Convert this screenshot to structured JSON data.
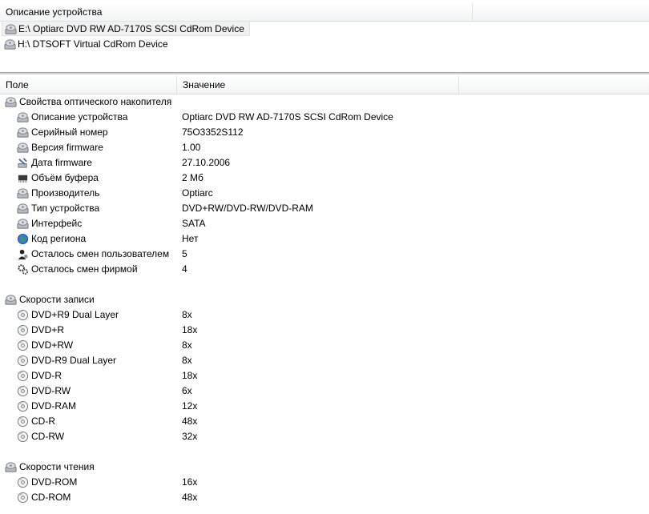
{
  "top_header": {
    "col1": "Описание устройства"
  },
  "devices": [
    {
      "label": "E:\\  Optiarc DVD RW AD-7170S SCSI CdRom Device",
      "selected": true
    },
    {
      "label": "H:\\  DTSOFT Virtual CdRom Device",
      "selected": false
    }
  ],
  "prop_header": {
    "field": "Поле",
    "value": "Значение"
  },
  "groups": [
    {
      "title": "Свойства оптического накопителя",
      "items": [
        {
          "name": "Описание устройства",
          "value": "Optiarc DVD RW AD-7170S SCSI CdRom Device",
          "icon": "drive"
        },
        {
          "name": "Серийный номер",
          "value": "75O3352S112",
          "icon": "drive"
        },
        {
          "name": "Версия firmware",
          "value": "1.00",
          "icon": "drive"
        },
        {
          "name": "Дата firmware",
          "value": "27.10.2006",
          "icon": "tools"
        },
        {
          "name": "Объём буфера",
          "value": "2 Мб",
          "icon": "chip"
        },
        {
          "name": "Производитель",
          "value": "Optiarc",
          "icon": "drive"
        },
        {
          "name": "Тип устройства",
          "value": "DVD+RW/DVD-RW/DVD-RAM",
          "icon": "drive"
        },
        {
          "name": "Интерфейс",
          "value": "SATA",
          "icon": "drive"
        },
        {
          "name": "Код региона",
          "value": "Нет",
          "icon": "globe"
        },
        {
          "name": "Осталось смен пользователем",
          "value": "5",
          "icon": "user"
        },
        {
          "name": "Осталось смен фирмой",
          "value": "4",
          "icon": "gears"
        }
      ]
    },
    {
      "title": "Скорости записи",
      "items": [
        {
          "name": "DVD+R9 Dual Layer",
          "value": "8x",
          "icon": "disc"
        },
        {
          "name": "DVD+R",
          "value": "18x",
          "icon": "disc"
        },
        {
          "name": "DVD+RW",
          "value": "8x",
          "icon": "disc"
        },
        {
          "name": "DVD-R9 Dual Layer",
          "value": "8x",
          "icon": "disc"
        },
        {
          "name": "DVD-R",
          "value": "18x",
          "icon": "disc"
        },
        {
          "name": "DVD-RW",
          "value": "6x",
          "icon": "disc"
        },
        {
          "name": "DVD-RAM",
          "value": "12x",
          "icon": "disc"
        },
        {
          "name": "CD-R",
          "value": "48x",
          "icon": "disc"
        },
        {
          "name": "CD-RW",
          "value": "32x",
          "icon": "disc"
        }
      ]
    },
    {
      "title": "Скорости чтения",
      "items": [
        {
          "name": "DVD-ROM",
          "value": "16x",
          "icon": "disc"
        },
        {
          "name": "CD-ROM",
          "value": "48x",
          "icon": "disc"
        }
      ]
    }
  ]
}
